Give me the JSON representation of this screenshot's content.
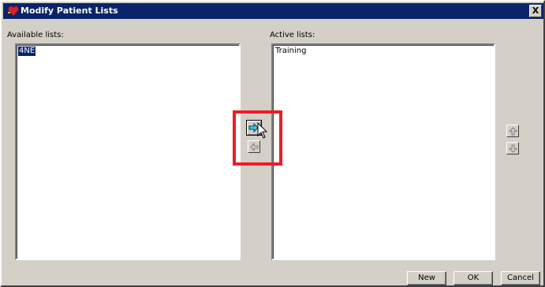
{
  "window": {
    "title": "Modify Patient Lists",
    "close_label": "X"
  },
  "available": {
    "label": "Available lists:",
    "items": [
      "4NE"
    ]
  },
  "active": {
    "label": "Active lists:",
    "items": [
      "Training"
    ]
  },
  "buttons": {
    "new": "New",
    "ok": "OK",
    "cancel": "Cancel"
  },
  "colors": {
    "titlebar": "#0a246a",
    "highlight": "#ee1c25",
    "dialog_bg": "#d4d0c8",
    "arrow_accent": "#00a0c0"
  },
  "icons": {
    "move_right": "arrow-right-icon",
    "move_left": "arrow-left-icon",
    "move_up": "arrow-up-icon",
    "move_down": "arrow-down-icon"
  }
}
